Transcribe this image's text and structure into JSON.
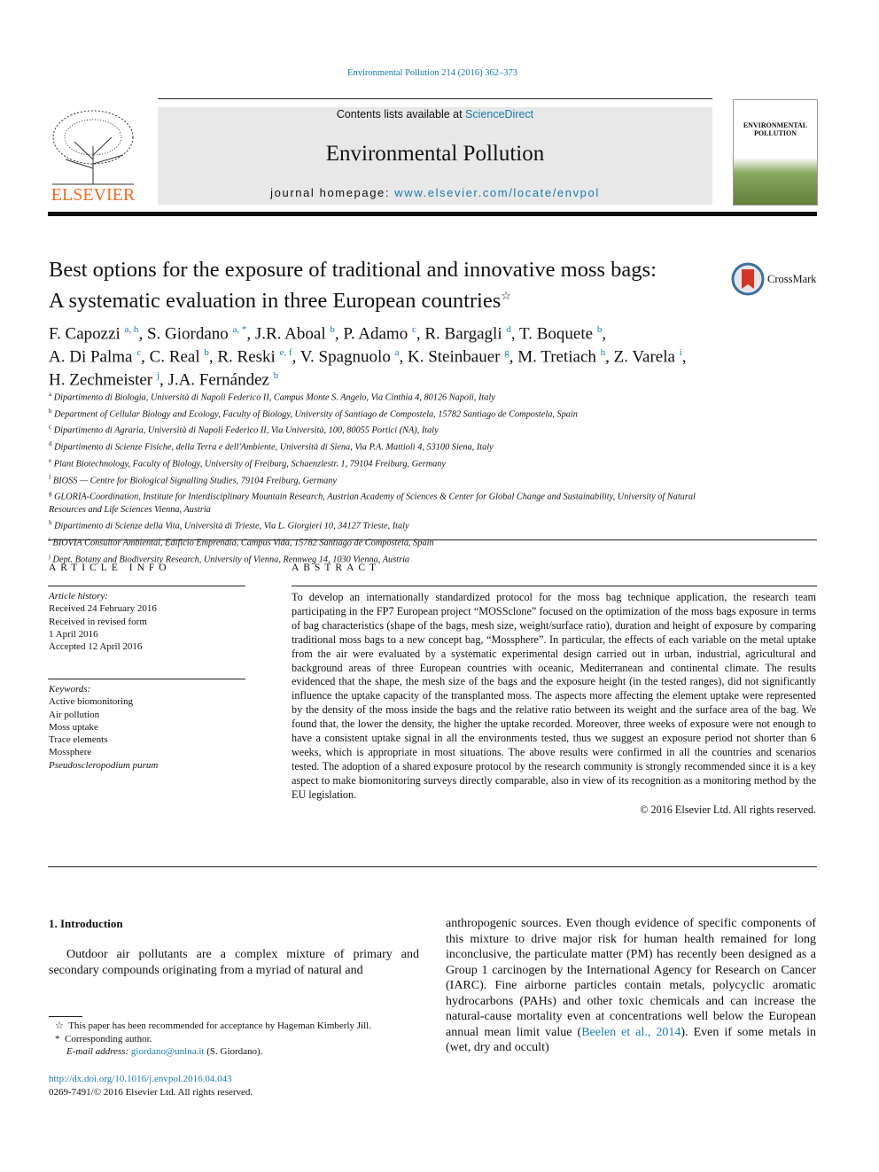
{
  "header": {
    "citation": "Environmental Pollution 214 (2016) 362–373",
    "publisher_logo_text": "ELSEVIER",
    "contents_prefix": "Contents lists available at ",
    "contents_link": "ScienceDirect",
    "journal_title": "Environmental Pollution",
    "homepage_prefix": "journal homepage: ",
    "homepage_link": "www.elsevier.com/locate/envpol",
    "cover_title": "ENVIRONMENTAL POLLUTION"
  },
  "article": {
    "title_line1": "Best options for the exposure of traditional and innovative moss bags:",
    "title_line2": "A systematic evaluation in three European countries",
    "title_mark": "☆",
    "crossmark_label": "CrossMark",
    "authors": [
      {
        "name": "F. Capozzi",
        "sup": "a, h",
        "sep": ", "
      },
      {
        "name": "S. Giordano",
        "sup": "a, *",
        "sep": ", "
      },
      {
        "name": "J.R. Aboal",
        "sup": "b",
        "sep": ", "
      },
      {
        "name": "P. Adamo",
        "sup": "c",
        "sep": ", "
      },
      {
        "name": "R. Bargagli",
        "sup": "d",
        "sep": ", "
      },
      {
        "name": "T. Boquete",
        "sup": "b",
        "sep": ","
      },
      {
        "name": "A. Di Palma",
        "sup": "c",
        "sep": ", "
      },
      {
        "name": "C. Real",
        "sup": "b",
        "sep": ", "
      },
      {
        "name": "R. Reski",
        "sup": "e, f",
        "sep": ", "
      },
      {
        "name": "V. Spagnuolo",
        "sup": "a",
        "sep": ", "
      },
      {
        "name": "K. Steinbauer",
        "sup": "g",
        "sep": ", "
      },
      {
        "name": "M. Tretiach",
        "sup": "h",
        "sep": ", "
      },
      {
        "name": "Z. Varela",
        "sup": "i",
        "sep": ","
      },
      {
        "name": "H. Zechmeister",
        "sup": "j",
        "sep": ", "
      },
      {
        "name": "J.A. Fernández",
        "sup": "b",
        "sep": ""
      }
    ],
    "affiliations": [
      {
        "key": "a",
        "text": "Dipartimento di Biologia, Università di Napoli Federico II, Campus Monte S. Angelo, Via Cinthia 4, 80126 Napoli, Italy"
      },
      {
        "key": "b",
        "text": "Department of Cellular Biology and Ecology, Faculty of Biology, University of Santiago de Compostela, 15782 Santiago de Compostela, Spain"
      },
      {
        "key": "c",
        "text": "Dipartimento di Agraria, Università di Napoli Federico II, Via Università, 100, 80055 Portici (NA), Italy"
      },
      {
        "key": "d",
        "text": "Dipartimento di Scienze Fisiche, della Terra e dell'Ambiente, Università di Siena, Via P.A. Mattioli 4, 53100 Siena, Italy"
      },
      {
        "key": "e",
        "text": "Plant Biotechnology, Faculty of Biology, University of Freiburg, Schaenzlestr. 1, 79104 Freiburg, Germany"
      },
      {
        "key": "f",
        "text": "BIOSS — Centre for Biological Signalling Studies, 79104 Freiburg, Germany"
      },
      {
        "key": "g",
        "text": "GLORIA-Coordination, Institute for Interdisciplinary Mountain Research, Austrian Academy of Sciences & Center for Global Change and Sustainability, University of Natural Resources and Life Sciences Vienna, Austria"
      },
      {
        "key": "h",
        "text": "Dipartimento di Scienze della Vita, Università di Trieste, Via L. Giorgieri 10, 34127 Trieste, Italy"
      },
      {
        "key": "i",
        "text": "BIOVIA Consultor Ambiental, Edificio Emprendia, Campus Vida, 15782 Santiago de Compostela, Spain"
      },
      {
        "key": "j",
        "text": "Dept. Botany and Biodiversity Research, University of Vienna, Rennweg 14, 1030 Vienna, Austria"
      }
    ]
  },
  "article_info": {
    "heading": "ARTICLE INFO",
    "history_label": "Article history:",
    "history": [
      "Received 24 February 2016",
      "Received in revised form",
      "1 April 2016",
      "Accepted 12 April 2016"
    ],
    "keywords_label": "Keywords:",
    "keywords": [
      "Active biomonitoring",
      "Air pollution",
      "Moss uptake",
      "Trace elements",
      "Mossphere",
      "Pseudoscleropodium purum"
    ]
  },
  "abstract": {
    "heading": "ABSTRACT",
    "text": "To develop an internationally standardized protocol for the moss bag technique application, the research team participating in the FP7 European project “MOSSclone” focused on the optimization of the moss bags exposure in terms of bag characteristics (shape of the bags, mesh size, weight/surface ratio), duration and height of exposure by comparing traditional moss bags to a new concept bag, “Mossphere”. In particular, the effects of each variable on the metal uptake from the air were evaluated by a systematic experimental design carried out in urban, industrial, agricultural and background areas of three European countries with oceanic, Mediterranean and continental climate. The results evidenced that the shape, the mesh size of the bags and the exposure height (in the tested ranges), did not significantly influence the uptake capacity of the transplanted moss. The aspects more affecting the element uptake were represented by the density of the moss inside the bags and the relative ratio between its weight and the surface area of the bag. We found that, the lower the density, the higher the uptake recorded. Moreover, three weeks of exposure were not enough to have a consistent uptake signal in all the environments tested, thus we suggest an exposure period not shorter than 6 weeks, which is appropriate in most situations. The above results were confirmed in all the countries and scenarios tested. The adoption of a shared exposure protocol by the research community is strongly recommended since it is a key aspect to make biomonitoring surveys directly comparable, also in view of its recognition as a monitoring method by the EU legislation.",
    "copyright": "© 2016 Elsevier Ltd. All rights reserved."
  },
  "intro": {
    "heading": "1.  Introduction",
    "col1": "Outdoor air pollutants are a complex mixture of primary and secondary compounds originating from a myriad of natural and",
    "col2_text": "anthropogenic sources. Even though evidence of specific components of this mixture to drive major risk for human health remained for long inconclusive, the particulate matter (PM) has recently been designed as a Group 1 carcinogen by the International Agency for Research on Cancer (IARC). Fine airborne particles contain metals, polycyclic aromatic hydrocarbons (PAHs) and other toxic chemicals and can increase the natural-cause mortality even at concentrations well below the European annual mean limit value (",
    "col2_cite": "Beelen et al., 2014",
    "col2_tail": "). Even if some metals in (wet, dry and occult)"
  },
  "footnotes": {
    "star_mark": "☆",
    "star_text": "This paper has been recommended for acceptance by Hageman Kimberly Jill.",
    "corr_mark": "*",
    "corr_text": "Corresponding author.",
    "email_label": "E-mail address: ",
    "email": "giordano@unina.it",
    "email_name": " (S. Giordano)."
  },
  "footer": {
    "doi": "http://dx.doi.org/10.1016/j.envpol.2016.04.043",
    "issn": "0269-7491/© 2016 Elsevier Ltd. All rights reserved."
  },
  "colors": {
    "link": "#1a7ab0",
    "elsevier_orange": "#f26b21",
    "banner_bg": "#e8e8e8"
  }
}
